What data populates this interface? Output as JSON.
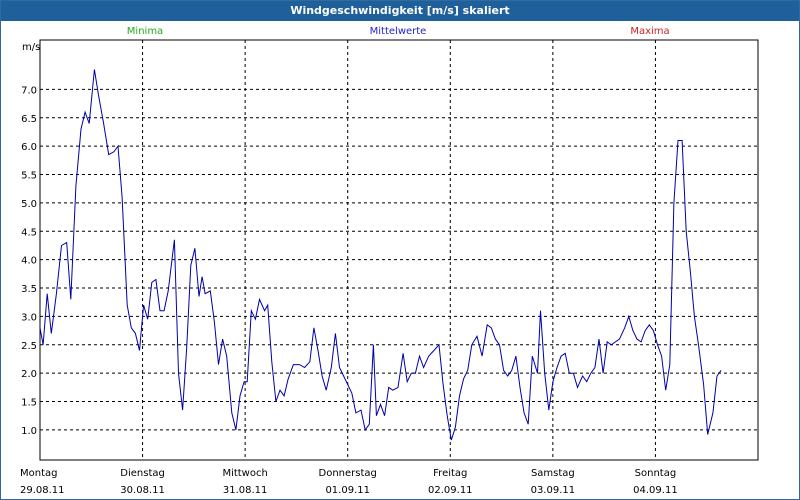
{
  "window": {
    "title": "Windgeschwindigkeit [m/s] skaliert"
  },
  "legend": {
    "minima": "Minima",
    "mittelwerte": "Mittelwerte",
    "maxima": "Maxima",
    "colors": {
      "minima": "#22aa22",
      "mittelwerte": "#2222cc",
      "maxima": "#cc2222"
    }
  },
  "chart_data": {
    "type": "line",
    "title": "Windgeschwindigkeit [m/s] skaliert",
    "ylabel": "m/s",
    "ylim": [
      0.47,
      7.87
    ],
    "yticks": [
      "1.0",
      "1.5",
      "2.0",
      "2.5",
      "3.0",
      "3.5",
      "4.0",
      "4.5",
      "5.0",
      "5.5",
      "6.0",
      "6.5",
      "7.0"
    ],
    "xlim": [
      0,
      7
    ],
    "xticks": [
      {
        "day": "Montag",
        "date": "29.08.11"
      },
      {
        "day": "Dienstag",
        "date": "30.08.11"
      },
      {
        "day": "Mittwoch",
        "date": "31.08.11"
      },
      {
        "day": "Donnerstag",
        "date": "01.09.11"
      },
      {
        "day": "Freitag",
        "date": "02.09.11"
      },
      {
        "day": "Samstag",
        "date": "03.09.11"
      },
      {
        "day": "Sonntag",
        "date": "04.09.11"
      }
    ],
    "grid": true,
    "line_color": "#0000aa",
    "series": [
      {
        "name": "Mittelwerte",
        "points": [
          [
            0.0,
            2.8
          ],
          [
            0.03,
            2.5
          ],
          [
            0.07,
            3.4
          ],
          [
            0.11,
            2.7
          ],
          [
            0.16,
            3.4
          ],
          [
            0.21,
            4.25
          ],
          [
            0.26,
            4.3
          ],
          [
            0.3,
            3.3
          ],
          [
            0.35,
            5.3
          ],
          [
            0.4,
            6.3
          ],
          [
            0.44,
            6.6
          ],
          [
            0.48,
            6.4
          ],
          [
            0.53,
            7.35
          ],
          [
            0.57,
            6.9
          ],
          [
            0.62,
            6.4
          ],
          [
            0.67,
            5.85
          ],
          [
            0.72,
            5.9
          ],
          [
            0.76,
            6.0
          ],
          [
            0.8,
            5.1
          ],
          [
            0.85,
            3.2
          ],
          [
            0.89,
            2.8
          ],
          [
            0.93,
            2.7
          ],
          [
            0.97,
            2.4
          ],
          [
            1.01,
            3.2
          ],
          [
            1.05,
            2.95
          ],
          [
            1.09,
            3.6
          ],
          [
            1.13,
            3.65
          ],
          [
            1.17,
            3.1
          ],
          [
            1.21,
            3.1
          ],
          [
            1.25,
            3.45
          ],
          [
            1.31,
            4.35
          ],
          [
            1.35,
            2.0
          ],
          [
            1.39,
            1.35
          ],
          [
            1.43,
            2.45
          ],
          [
            1.47,
            3.9
          ],
          [
            1.51,
            4.2
          ],
          [
            1.55,
            3.35
          ],
          [
            1.58,
            3.7
          ],
          [
            1.61,
            3.4
          ],
          [
            1.66,
            3.45
          ],
          [
            1.7,
            2.9
          ],
          [
            1.74,
            2.15
          ],
          [
            1.78,
            2.6
          ],
          [
            1.82,
            2.3
          ],
          [
            1.87,
            1.3
          ],
          [
            1.91,
            1.0
          ],
          [
            1.95,
            1.6
          ],
          [
            1.99,
            1.85
          ],
          [
            2.02,
            1.85
          ],
          [
            2.06,
            3.1
          ],
          [
            2.1,
            2.95
          ],
          [
            2.14,
            3.3
          ],
          [
            2.19,
            3.1
          ],
          [
            2.22,
            3.2
          ],
          [
            2.26,
            2.2
          ],
          [
            2.3,
            1.5
          ],
          [
            2.34,
            1.7
          ],
          [
            2.38,
            1.6
          ],
          [
            2.42,
            1.9
          ],
          [
            2.47,
            2.15
          ],
          [
            2.53,
            2.15
          ],
          [
            2.58,
            2.1
          ],
          [
            2.63,
            2.2
          ],
          [
            2.67,
            2.8
          ],
          [
            2.71,
            2.4
          ],
          [
            2.75,
            1.95
          ],
          [
            2.79,
            1.7
          ],
          [
            2.84,
            2.1
          ],
          [
            2.88,
            2.7
          ],
          [
            2.92,
            2.1
          ],
          [
            2.96,
            1.95
          ],
          [
            3.0,
            1.8
          ],
          [
            3.04,
            1.65
          ],
          [
            3.08,
            1.3
          ],
          [
            3.13,
            1.35
          ],
          [
            3.17,
            1.0
          ],
          [
            3.21,
            1.1
          ],
          [
            3.25,
            2.5
          ],
          [
            3.28,
            1.25
          ],
          [
            3.32,
            1.45
          ],
          [
            3.36,
            1.25
          ],
          [
            3.4,
            1.75
          ],
          [
            3.44,
            1.7
          ],
          [
            3.49,
            1.75
          ],
          [
            3.54,
            2.35
          ],
          [
            3.58,
            1.85
          ],
          [
            3.62,
            2.0
          ],
          [
            3.66,
            2.0
          ],
          [
            3.7,
            2.3
          ],
          [
            3.74,
            2.1
          ],
          [
            3.79,
            2.3
          ],
          [
            3.84,
            2.4
          ],
          [
            3.89,
            2.5
          ],
          [
            3.93,
            1.8
          ],
          [
            3.97,
            1.25
          ],
          [
            4.01,
            0.82
          ],
          [
            4.05,
            1.05
          ],
          [
            4.09,
            1.6
          ],
          [
            4.13,
            1.9
          ],
          [
            4.17,
            2.05
          ],
          [
            4.21,
            2.5
          ],
          [
            4.26,
            2.65
          ],
          [
            4.31,
            2.3
          ],
          [
            4.36,
            2.85
          ],
          [
            4.4,
            2.8
          ],
          [
            4.44,
            2.6
          ],
          [
            4.48,
            2.5
          ],
          [
            4.52,
            2.05
          ],
          [
            4.56,
            1.95
          ],
          [
            4.6,
            2.05
          ],
          [
            4.64,
            2.3
          ],
          [
            4.68,
            1.75
          ],
          [
            4.72,
            1.3
          ],
          [
            4.76,
            1.1
          ],
          [
            4.8,
            2.3
          ],
          [
            4.85,
            2.0
          ],
          [
            4.88,
            3.1
          ],
          [
            4.92,
            2.0
          ],
          [
            4.96,
            1.35
          ],
          [
            5.0,
            1.85
          ],
          [
            5.04,
            2.1
          ],
          [
            5.08,
            2.3
          ],
          [
            5.12,
            2.35
          ],
          [
            5.16,
            2.0
          ],
          [
            5.2,
            2.0
          ],
          [
            5.24,
            1.75
          ],
          [
            5.29,
            1.95
          ],
          [
            5.33,
            1.85
          ],
          [
            5.37,
            2.0
          ],
          [
            5.41,
            2.1
          ],
          [
            5.45,
            2.6
          ],
          [
            5.49,
            2.0
          ],
          [
            5.53,
            2.55
          ],
          [
            5.57,
            2.5
          ],
          [
            5.61,
            2.55
          ],
          [
            5.65,
            2.6
          ],
          [
            5.7,
            2.8
          ],
          [
            5.74,
            3.0
          ],
          [
            5.78,
            2.75
          ],
          [
            5.82,
            2.6
          ],
          [
            5.86,
            2.55
          ],
          [
            5.9,
            2.75
          ],
          [
            5.94,
            2.85
          ],
          [
            5.98,
            2.75
          ],
          [
            6.02,
            2.5
          ],
          [
            6.06,
            2.3
          ],
          [
            6.1,
            1.7
          ],
          [
            6.14,
            2.15
          ],
          [
            6.18,
            5.0
          ],
          [
            6.22,
            6.1
          ],
          [
            6.26,
            6.1
          ],
          [
            6.3,
            4.5
          ],
          [
            6.34,
            3.8
          ],
          [
            6.38,
            3.0
          ],
          [
            6.42,
            2.5
          ],
          [
            6.47,
            1.8
          ],
          [
            6.51,
            0.92
          ],
          [
            6.56,
            1.3
          ],
          [
            6.6,
            1.95
          ],
          [
            6.64,
            2.05
          ]
        ]
      }
    ]
  }
}
